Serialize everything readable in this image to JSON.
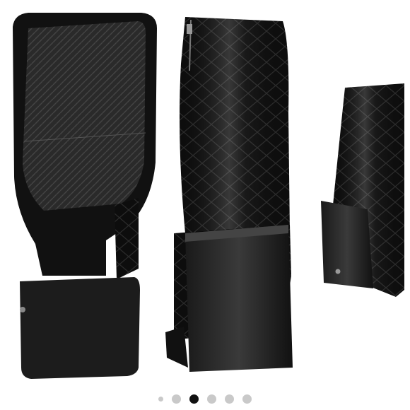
{
  "gallery": {
    "image_description": "",
    "current_index": 2,
    "total_images": 6,
    "dots": [
      {
        "state": "small"
      },
      {
        "state": "inactive"
      },
      {
        "state": "active"
      },
      {
        "state": "inactive"
      },
      {
        "state": "inactive"
      },
      {
        "state": "inactive"
      }
    ],
    "colors": {
      "active_dot": "#111111",
      "inactive_dot": "#c9c9c9",
      "boot_black": "#0d0d0d",
      "background": "#ffffff"
    }
  }
}
